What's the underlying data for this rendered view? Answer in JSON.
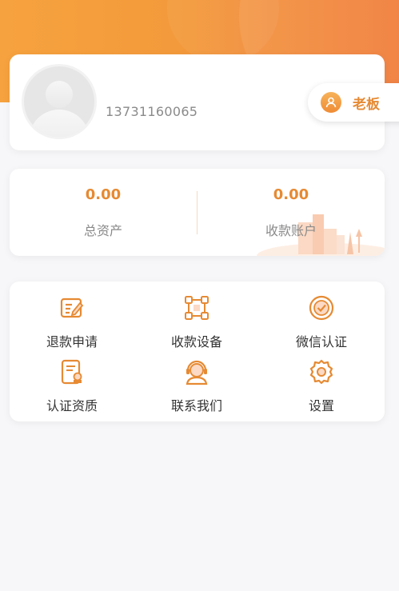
{
  "profile": {
    "phone": "13731160065",
    "role_label": "老板",
    "avatar": "default-avatar"
  },
  "stats": [
    {
      "value": "0.00",
      "label": "总资产"
    },
    {
      "value": "0.00",
      "label": "收款账户"
    }
  ],
  "menu": [
    {
      "label": "退款申请",
      "icon": "edit-form-icon"
    },
    {
      "label": "收款设备",
      "icon": "device-network-icon"
    },
    {
      "label": "微信认证",
      "icon": "badge-check-icon"
    },
    {
      "label": "认证资质",
      "icon": "certificate-doc-icon"
    },
    {
      "label": "联系我们",
      "icon": "headset-support-icon"
    },
    {
      "label": "设置",
      "icon": "gear-icon"
    }
  ],
  "colors": {
    "accent": "#e68a33",
    "header_gradient_start": "#f6a23e",
    "header_gradient_end": "#f07b38"
  }
}
